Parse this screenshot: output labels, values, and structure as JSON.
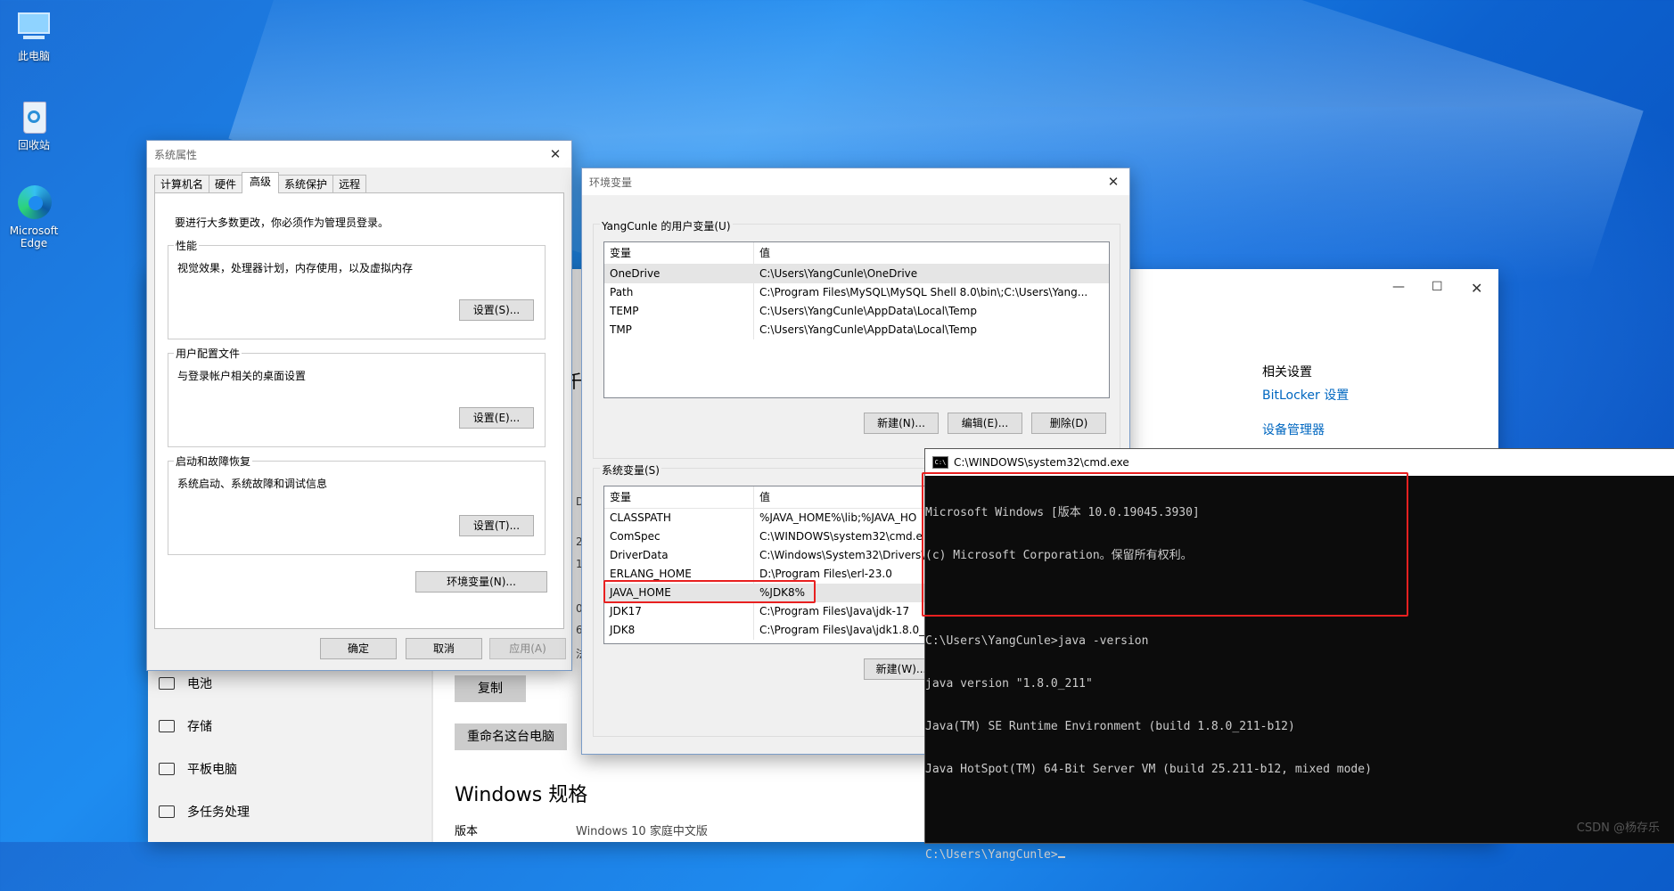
{
  "desktop": {
    "icons": [
      {
        "label": "此电脑"
      },
      {
        "label": "回收站"
      },
      {
        "label": "Microsoft Edge"
      }
    ]
  },
  "settings": {
    "nav": [
      "电池",
      "存储",
      "平板电脑",
      "多任务处理"
    ],
    "buttons": {
      "copy": "复制",
      "rename": "重命名这台电脑"
    },
    "spec_title": "Windows 规格",
    "edition_label": "版本",
    "edition_value": "Windows 10 家庭中文版",
    "related_title": "相关设置",
    "links": [
      "BitLocker 设置",
      "设备管理器"
    ],
    "peek_chars": [
      "千",
      "D",
      "2",
      "1",
      "0",
      "6",
      "法"
    ]
  },
  "sysprop": {
    "title": "系统属性",
    "tabs": [
      "计算机名",
      "硬件",
      "高级",
      "系统保护",
      "远程"
    ],
    "admin_note": "要进行大多数更改，你必须作为管理员登录。",
    "groups": [
      {
        "title": "性能",
        "desc": "视觉效果，处理器计划，内存使用，以及虚拟内存",
        "button": "设置(S)..."
      },
      {
        "title": "用户配置文件",
        "desc": "与登录帐户相关的桌面设置",
        "button": "设置(E)..."
      },
      {
        "title": "启动和故障恢复",
        "desc": "系统启动、系统故障和调试信息",
        "button": "设置(T)..."
      }
    ],
    "env_button": "环境变量(N)...",
    "ok": "确定",
    "cancel": "取消",
    "apply": "应用(A)"
  },
  "envvars": {
    "title": "环境变量",
    "user_section": "YangCunle 的用户变量(U)",
    "system_section": "系统变量(S)",
    "col_var": "变量",
    "col_val": "值",
    "user_rows": [
      {
        "name": "OneDrive",
        "value": "C:\\Users\\YangCunle\\OneDrive"
      },
      {
        "name": "Path",
        "value": "C:\\Program Files\\MySQL\\MySQL Shell 8.0\\bin\\;C:\\Users\\Yang..."
      },
      {
        "name": "TEMP",
        "value": "C:\\Users\\YangCunle\\AppData\\Local\\Temp"
      },
      {
        "name": "TMP",
        "value": "C:\\Users\\YangCunle\\AppData\\Local\\Temp"
      }
    ],
    "user_buttons": [
      "新建(N)...",
      "编辑(E)...",
      "删除(D)"
    ],
    "system_rows": [
      {
        "name": "CLASSPATH",
        "value": "%JAVA_HOME%\\lib;%JAVA_HO"
      },
      {
        "name": "ComSpec",
        "value": "C:\\WINDOWS\\system32\\cmd.e"
      },
      {
        "name": "DriverData",
        "value": "C:\\Windows\\System32\\Drivers\\"
      },
      {
        "name": "ERLANG_HOME",
        "value": "D:\\Program Files\\erl-23.0"
      },
      {
        "name": "JAVA_HOME",
        "value": "%JDK8%"
      },
      {
        "name": "JDK17",
        "value": "C:\\Program Files\\Java\\jdk-17"
      },
      {
        "name": "JDK8",
        "value": "C:\\Program Files\\Java\\jdk1.8.0_2"
      }
    ],
    "system_new_button": "新建(W)..."
  },
  "cmd": {
    "title": "C:\\WINDOWS\\system32\\cmd.exe",
    "logo": "C:\\",
    "lines": [
      "Microsoft Windows [版本 10.0.19045.3930]",
      "(c) Microsoft Corporation。保留所有权利。",
      "",
      "C:\\Users\\YangCunle>java -version",
      "java version \"1.8.0_211\"",
      "Java(TM) SE Runtime Environment (build 1.8.0_211-b12)",
      "Java HotSpot(TM) 64-Bit Server VM (build 25.211-b12, mixed mode)",
      "",
      "C:\\Users\\YangCunle>"
    ]
  },
  "watermark": "CSDN @杨存乐",
  "colors": {
    "highlight": "#e82020",
    "link": "#0067c0",
    "desktop": "#1e8cf0"
  }
}
